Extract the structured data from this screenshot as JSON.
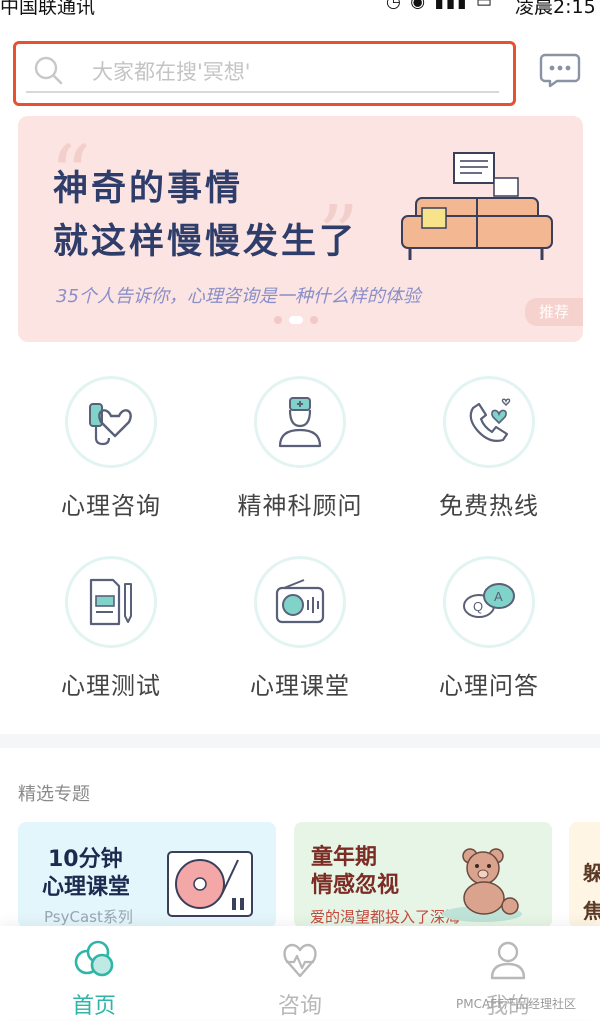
{
  "status_bar": {
    "carrier": "中国联通讯",
    "icons": "◷ ◉ ▮▮▮ ▭",
    "time": "凌晨2:15"
  },
  "search": {
    "placeholder": "大家都在搜'冥想'"
  },
  "banner": {
    "headline_1": "神奇的事情",
    "headline_2": "就这样慢慢发生了",
    "subtitle": "35个人告诉你，心理咨询是一种什么样的体验",
    "tag": "推荐",
    "pagination": {
      "count": 3,
      "active": 1
    }
  },
  "quick_entries": [
    {
      "label": "心理咨询",
      "icon": "heart-stethoscope-icon"
    },
    {
      "label": "精神科顾问",
      "icon": "doctor-icon"
    },
    {
      "label": "免费热线",
      "icon": "phone-heart-icon"
    },
    {
      "label": "心理测试",
      "icon": "test-paper-icon"
    },
    {
      "label": "心理课堂",
      "icon": "radio-icon"
    },
    {
      "label": "心理问答",
      "icon": "qa-bubble-icon"
    }
  ],
  "featured": {
    "section_title": "精选专题",
    "cards": [
      {
        "title_1": "10分钟",
        "title_2": "心理课堂",
        "subtitle": "PsyCast系列",
        "icon": "record-player-icon"
      },
      {
        "title_1": "童年期",
        "title_2": "情感忽视",
        "subtitle": "爱的渴望都投入了深海",
        "icon": "teddy-bear-icon"
      },
      {
        "title_1": "躲",
        "title_2": "焦"
      }
    ]
  },
  "bottom_nav": {
    "items": [
      {
        "label": "首页",
        "icon": "home-icon",
        "active": true
      },
      {
        "label": "咨询",
        "icon": "heart-pulse-icon",
        "active": false
      },
      {
        "label": "我的",
        "icon": "profile-icon",
        "active": false
      }
    ]
  },
  "watermark": "PMCAFF产品经理社区",
  "colors": {
    "accent": "#2fb5a7",
    "search_highlight": "#e7512f",
    "banner_bg": "#fbe4e1",
    "headline": "#2f3d6b"
  }
}
